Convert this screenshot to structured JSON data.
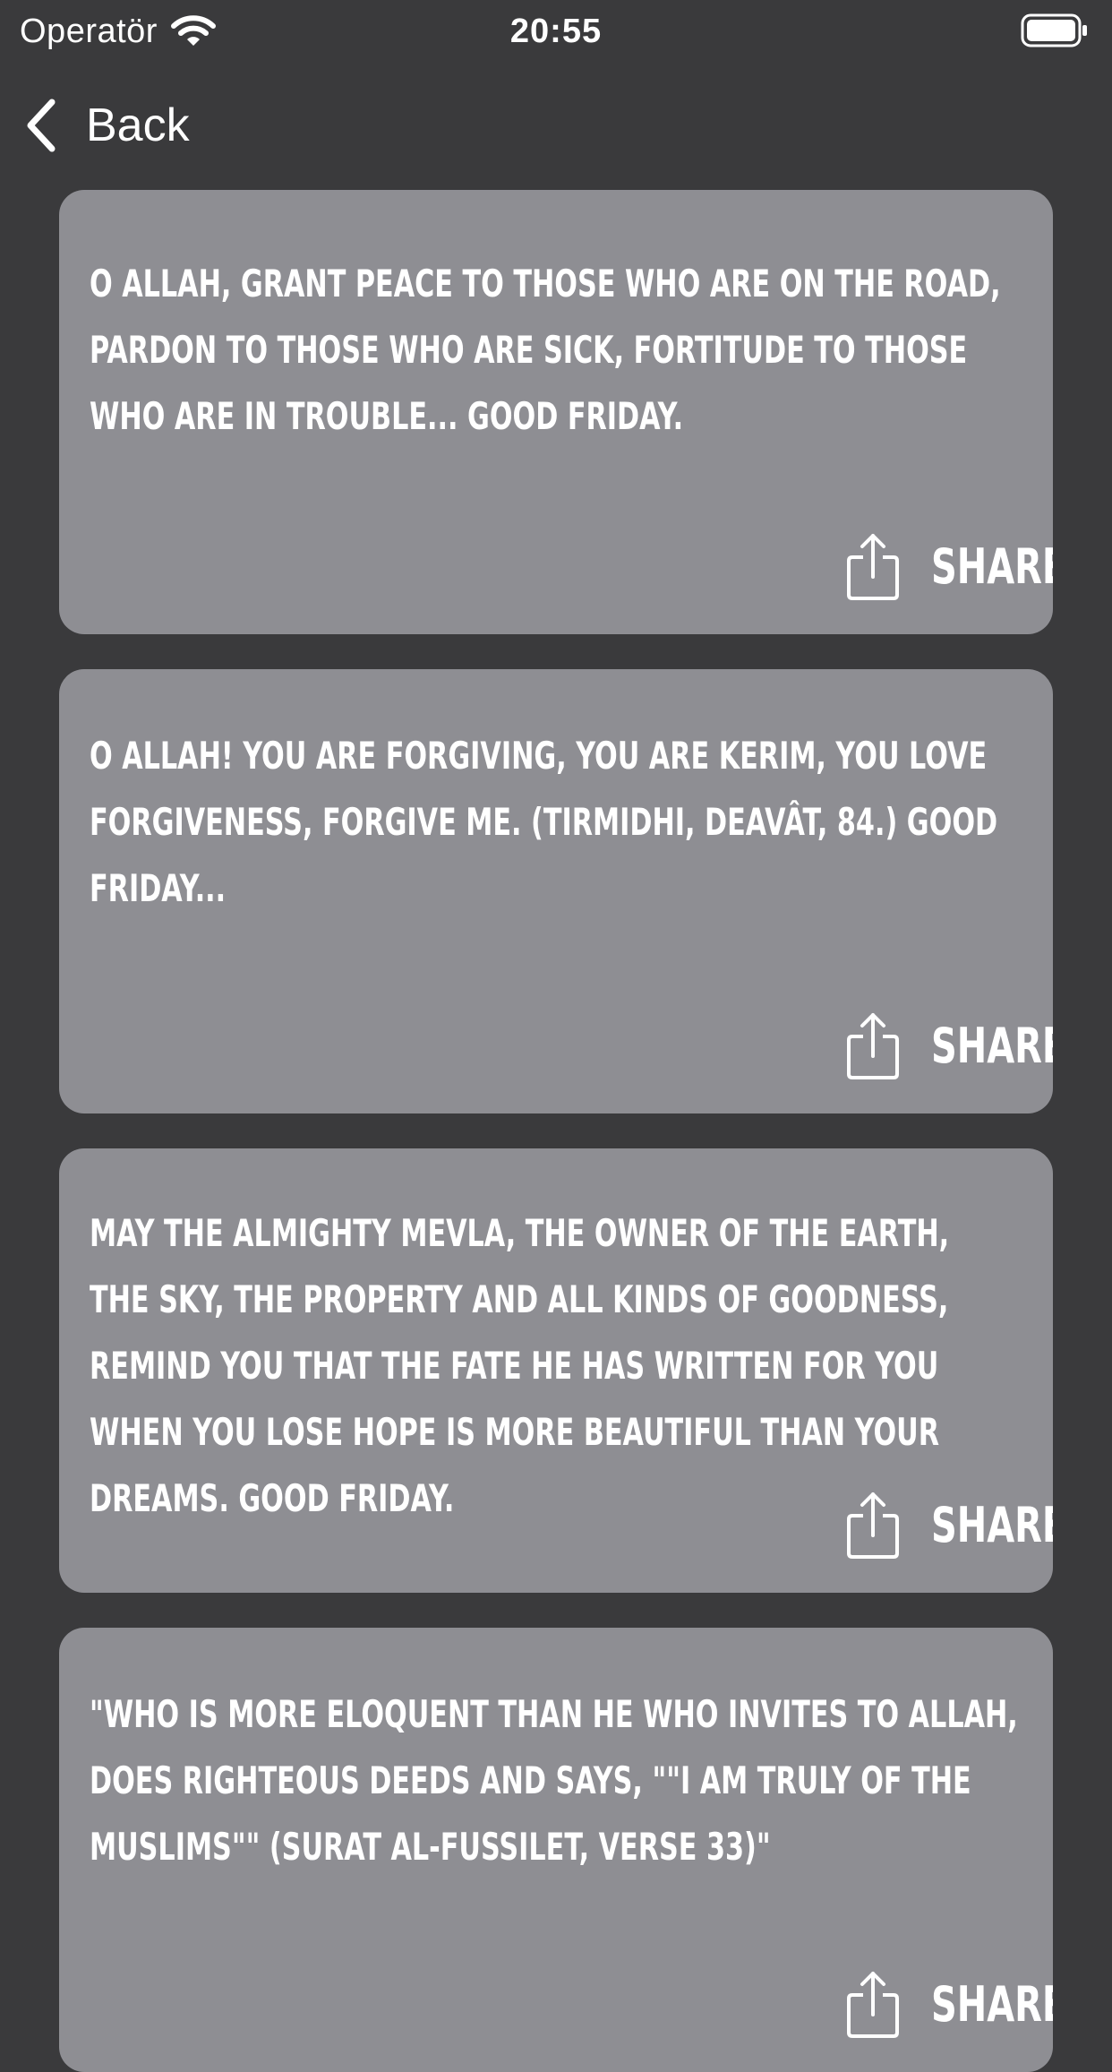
{
  "status_bar": {
    "carrier": "Operatör",
    "time": "20:55"
  },
  "nav": {
    "back_label": "Back"
  },
  "cards": [
    {
      "text": "O ALLAH, GRANT PEACE TO THOSE WHO ARE ON THE ROAD, PARDON TO THOSE WHO ARE SICK, FORTITUDE TO THOSE WHO ARE IN TROUBLE... GOOD FRIDAY.",
      "share_label": "SHARE"
    },
    {
      "text": "O ALLAH! YOU ARE FORGIVING, YOU ARE KERIM, YOU LOVE FORGIVENESS, FORGIVE ME. (TIRMIDHI, DEAVÂT, 84.) GOOD FRIDAY...",
      "share_label": "SHARE"
    },
    {
      "text": "MAY THE ALMIGHTY MEVLA, THE OWNER OF THE EARTH, THE SKY, THE PROPERTY AND ALL KINDS OF GOODNESS, REMIND YOU THAT THE FATE HE HAS WRITTEN FOR YOU WHEN YOU LOSE HOPE IS MORE BEAUTIFUL THAN YOUR DREAMS. GOOD FRIDAY.",
      "share_label": "SHARE"
    },
    {
      "text": "\"WHO IS MORE ELOQUENT THAN HE WHO INVITES TO ALLAH, DOES RIGHTEOUS DEEDS AND SAYS, \"\"I AM TRULY OF THE MUSLIMS\"\" (SURAT AL-FUSSILET, VERSE 33)\"",
      "share_label": "SHARE"
    }
  ],
  "colors": {
    "background": "#3a3a3c",
    "card": "#8e8e93",
    "text": "#ffffff"
  }
}
